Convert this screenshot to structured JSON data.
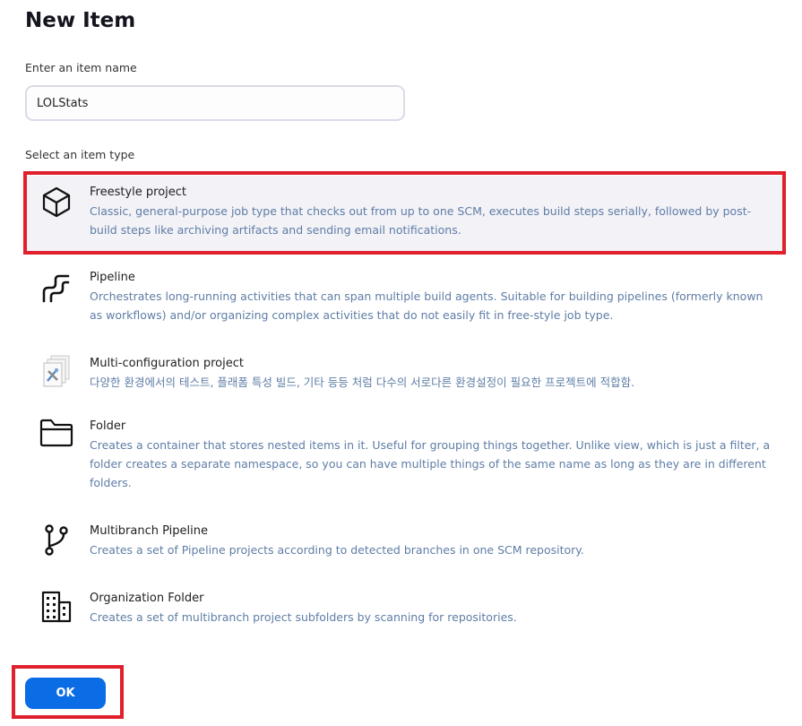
{
  "page_title": "New Item",
  "name_field": {
    "label": "Enter an item name",
    "value": "LOLStats"
  },
  "type_label": "Select an item type",
  "item_types": [
    {
      "icon": "cube-icon",
      "name": "Freestyle project",
      "description": "Classic, general-purpose job type that checks out from up to one SCM, executes build steps serially, followed by post-build steps like archiving artifacts and sending email notifications.",
      "selected": true
    },
    {
      "icon": "pipeline-icon",
      "name": "Pipeline",
      "description": "Orchestrates long-running activities that can span multiple build agents. Suitable for building pipelines (formerly known as workflows) and/or organizing complex activities that do not easily fit in free-style job type."
    },
    {
      "icon": "multi-config-icon",
      "name": "Multi-configuration project",
      "description": "다양한 환경에서의 테스트, 플래폼 특성 빌드, 기타 등등 처럼 다수의 서로다른 환경설정이 필요한 프로젝트에 적합함."
    },
    {
      "icon": "folder-icon",
      "name": "Folder",
      "description": "Creates a container that stores nested items in it. Useful for grouping things together. Unlike view, which is just a filter, a folder creates a separate namespace, so you can have multiple things of the same name as long as they are in different folders."
    },
    {
      "icon": "branch-icon",
      "name": "Multibranch Pipeline",
      "description": "Creates a set of Pipeline projects according to detected branches in one SCM repository."
    },
    {
      "icon": "building-icon",
      "name": "Organization Folder",
      "description": "Creates a set of multibranch project subfolders by scanning for repositories."
    }
  ],
  "ok_label": "OK",
  "colors": {
    "highlight": "#e0202d",
    "primary": "#0b6de6",
    "description": "#5f7da6",
    "selected_bg": "#f2f2f7"
  }
}
